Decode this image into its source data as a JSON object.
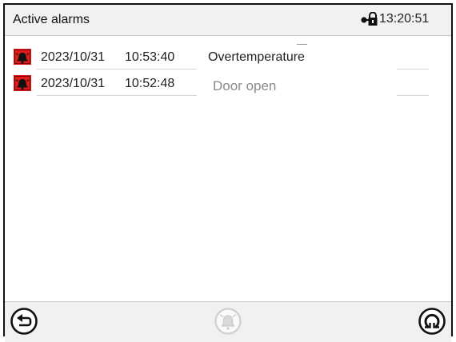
{
  "header": {
    "title": "Active alarms",
    "lock_icon": "lock-icon",
    "time": "13:20:51"
  },
  "alarms": [
    {
      "icon": "alarm-bell-icon",
      "date": "2023/10/31",
      "time": "10:53:40",
      "message": "Overtemperature"
    },
    {
      "icon": "alarm-bell-icon",
      "date": "2023/10/31",
      "time": "10:52:48",
      "message": "Door open"
    }
  ],
  "footer": {
    "back_icon": "back-arrow-icon",
    "mute_icon": "mute-alarm-icon",
    "refresh_icon": "refresh-icon"
  },
  "colors": {
    "alarm_red": "#e31b1b",
    "header_bg": "#f1f1f1"
  }
}
